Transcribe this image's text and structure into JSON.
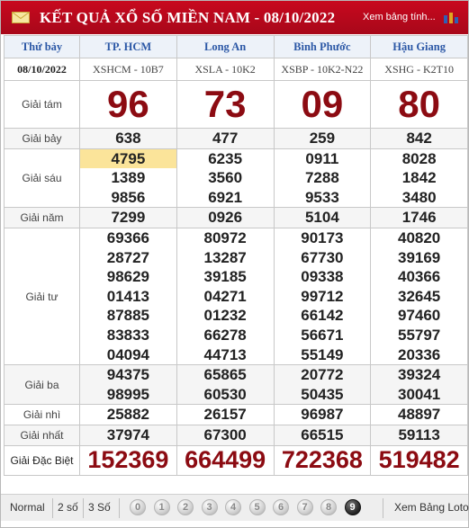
{
  "header": {
    "title": "KẾT QUẢ XỔ SỐ MIỀN NAM - 08/10/2022",
    "view_link": "Xem bảng tính...",
    "mail_icon": "mail-icon",
    "chart_icon": "bar-chart-icon"
  },
  "table": {
    "day": "Thứ bảy",
    "date": "08/10/2022",
    "provinces": [
      {
        "name": "TP. HCM",
        "code": "XSHCM - 10B7"
      },
      {
        "name": "Long An",
        "code": "XSLA - 10K2"
      },
      {
        "name": "Bình Phước",
        "code": "XSBP - 10K2-N22"
      },
      {
        "name": "Hậu Giang",
        "code": "XSHG - K2T10"
      }
    ],
    "prizes": [
      {
        "label": "Giải tám",
        "values": [
          [
            "96"
          ],
          [
            "73"
          ],
          [
            "09"
          ],
          [
            "80"
          ]
        ]
      },
      {
        "label": "Giải bảy",
        "values": [
          [
            "638"
          ],
          [
            "477"
          ],
          [
            "259"
          ],
          [
            "842"
          ]
        ]
      },
      {
        "label": "Giải sáu",
        "values": [
          [
            "4795",
            "1389",
            "9856"
          ],
          [
            "6235",
            "3560",
            "6921"
          ],
          [
            "0911",
            "7288",
            "9533"
          ],
          [
            "8028",
            "1842",
            "3480"
          ]
        ]
      },
      {
        "label": "Giải năm",
        "values": [
          [
            "7299"
          ],
          [
            "0926"
          ],
          [
            "5104"
          ],
          [
            "1746"
          ]
        ]
      },
      {
        "label": "Giải tư",
        "values": [
          [
            "69366",
            "28727",
            "98629",
            "01413",
            "87885",
            "83833",
            "04094"
          ],
          [
            "80972",
            "13287",
            "39185",
            "04271",
            "01232",
            "66278",
            "44713"
          ],
          [
            "90173",
            "67730",
            "09338",
            "99712",
            "66142",
            "56671",
            "55149"
          ],
          [
            "40820",
            "39169",
            "40366",
            "32645",
            "97460",
            "55797",
            "20336"
          ]
        ]
      },
      {
        "label": "Giải ba",
        "values": [
          [
            "94375",
            "98995"
          ],
          [
            "65865",
            "60530"
          ],
          [
            "20772",
            "50435"
          ],
          [
            "39324",
            "30041"
          ]
        ]
      },
      {
        "label": "Giải nhì",
        "values": [
          [
            "25882"
          ],
          [
            "26157"
          ],
          [
            "96987"
          ],
          [
            "48897"
          ]
        ]
      },
      {
        "label": "Giải nhất",
        "values": [
          [
            "37974"
          ],
          [
            "67300"
          ],
          [
            "66515"
          ],
          [
            "59113"
          ]
        ]
      },
      {
        "label": "Giải Đặc Biệt",
        "values": [
          [
            "152369"
          ],
          [
            "664499"
          ],
          [
            "722368"
          ],
          [
            "519482"
          ]
        ]
      }
    ],
    "highlighted": "4795"
  },
  "footer": {
    "normal": "Normal",
    "two": "2 số",
    "three": "3 Số",
    "digits": [
      "0",
      "1",
      "2",
      "3",
      "4",
      "5",
      "6",
      "7",
      "8",
      "9"
    ],
    "loto_link": "Xem Bảng Loto"
  }
}
